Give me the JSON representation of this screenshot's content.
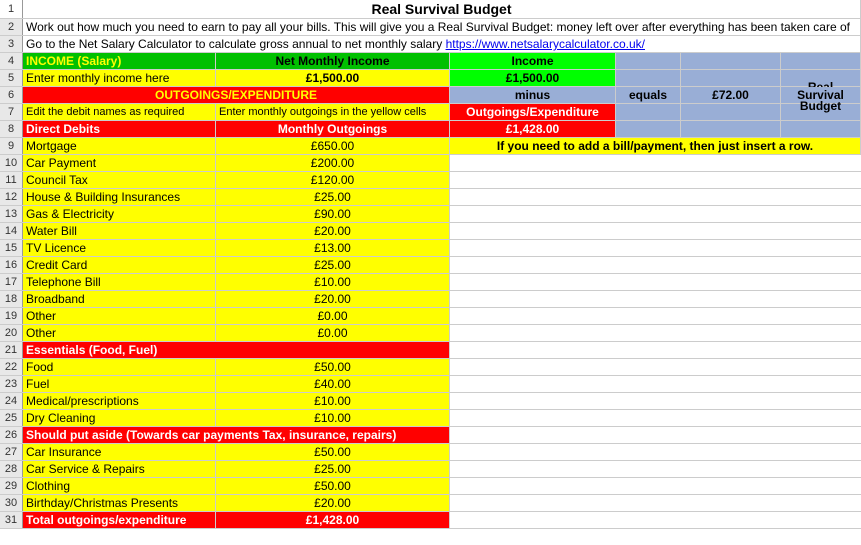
{
  "title": "Real Survival Budget",
  "desc2": "Work out how much you need to earn to pay all your bills. This will give you a Real Survival Budget: money left over after everything has been taken care of",
  "desc3_pre": "Go to the Net Salary Calculator to calculate gross annual to net monthly salary ",
  "desc3_link": "https://www.netsalarycalculator.co.uk/",
  "income_header": "INCOME (Salary)",
  "net_monthly_income": "Net Monthly Income",
  "income_label": "Income",
  "enter_monthly": "Enter monthly income here",
  "income_value": "£1,500.00",
  "income_right": "£1,500.00",
  "outgoings_header": "OUTGOINGS/EXPENDITURE",
  "minus": "minus",
  "equals": "equals",
  "result_value": "£72.00",
  "result_label": "Real Survival Budget",
  "edit_names": "Edit the debit names as required",
  "enter_outgoings": "Enter monthly outgoings in the yellow cells",
  "outgoings_exp": "Outgoings/Expenditure",
  "direct_debits": "Direct Debits",
  "monthly_outgoings": "Monthly Outgoings",
  "outgoings_total": "£1,428.00",
  "note_row": "If you need to add a bill/payment, then just insert a row.",
  "rows": [
    {
      "n": "9",
      "label": "Mortgage",
      "val": "£650.00"
    },
    {
      "n": "10",
      "label": "Car Payment",
      "val": "£200.00"
    },
    {
      "n": "11",
      "label": "Council Tax",
      "val": "£120.00"
    },
    {
      "n": "12",
      "label": "House & Building Insurances",
      "val": "£25.00"
    },
    {
      "n": "13",
      "label": "Gas & Electricity",
      "val": "£90.00"
    },
    {
      "n": "14",
      "label": "Water Bill",
      "val": "£20.00"
    },
    {
      "n": "15",
      "label": "TV Licence",
      "val": "£13.00"
    },
    {
      "n": "16",
      "label": "Credit Card",
      "val": "£25.00"
    },
    {
      "n": "17",
      "label": "Telephone Bill",
      "val": "£10.00"
    },
    {
      "n": "18",
      "label": "Broadband",
      "val": "£20.00"
    },
    {
      "n": "19",
      "label": "Other",
      "val": "£0.00"
    },
    {
      "n": "20",
      "label": "Other",
      "val": "£0.00"
    }
  ],
  "essentials_header": "Essentials (Food, Fuel)",
  "rows2": [
    {
      "n": "22",
      "label": "Food",
      "val": "£50.00"
    },
    {
      "n": "23",
      "label": "Fuel",
      "val": "£40.00"
    },
    {
      "n": "24",
      "label": "Medical/prescriptions",
      "val": "£10.00"
    },
    {
      "n": "25",
      "label": "Dry Cleaning",
      "val": "£10.00"
    }
  ],
  "aside_header": "Should put aside (Towards car payments Tax, insurance, repairs)",
  "rows3": [
    {
      "n": "27",
      "label": "Car Insurance",
      "val": "£50.00"
    },
    {
      "n": "28",
      "label": "Car Service & Repairs",
      "val": "£25.00"
    },
    {
      "n": "29",
      "label": "Clothing",
      "val": "£50.00"
    },
    {
      "n": "30",
      "label": "Birthday/Christmas Presents",
      "val": "£20.00"
    }
  ],
  "total_label": "Total outgoings/expenditure",
  "total_value": "£1,428.00"
}
